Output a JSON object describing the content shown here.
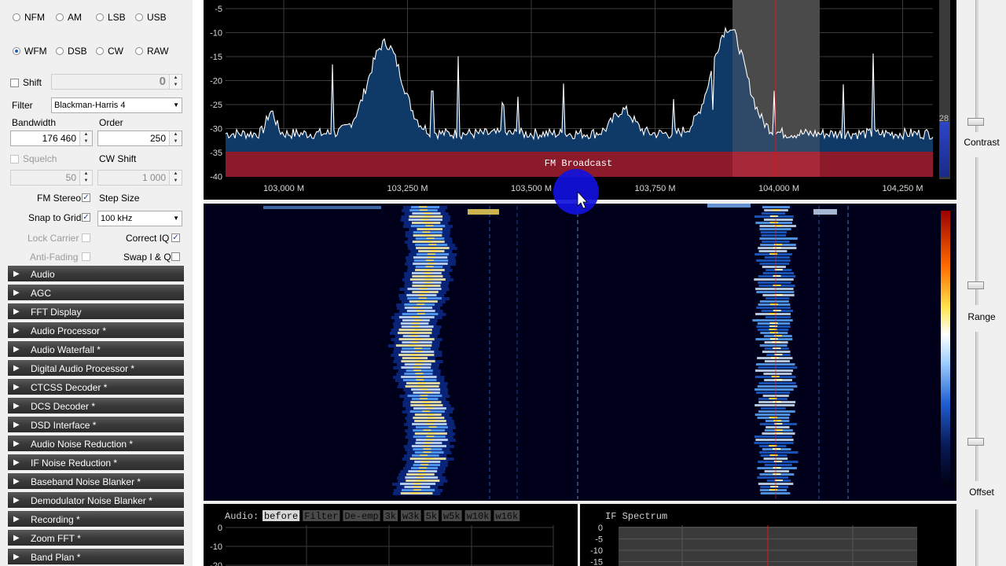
{
  "modes": {
    "nfm": "NFM",
    "am": "AM",
    "lsb": "LSB",
    "usb": "USB",
    "wfm": "WFM",
    "dsb": "DSB",
    "cw": "CW",
    "raw": "RAW",
    "selected": "WFM"
  },
  "shift": {
    "label": "Shift",
    "value": "0",
    "checked": false
  },
  "filter": {
    "label": "Filter",
    "value": "Blackman-Harris 4"
  },
  "bandwidth": {
    "label": "Bandwidth",
    "value": "176 460"
  },
  "order": {
    "label": "Order",
    "value": "250"
  },
  "squelch": {
    "label": "Squelch",
    "value": "50",
    "checked": false
  },
  "cw_shift": {
    "label": "CW Shift",
    "value": "1 000"
  },
  "fm_stereo": {
    "label": "FM Stereo",
    "checked": true
  },
  "step_size": {
    "label": "Step Size",
    "value": "100 kHz"
  },
  "snap_to_grid": {
    "label": "Snap to Grid",
    "checked": true
  },
  "lock_carrier": {
    "label": "Lock Carrier",
    "checked": false
  },
  "correct_iq": {
    "label": "Correct IQ",
    "checked": true
  },
  "anti_fading": {
    "label": "Anti-Fading",
    "checked": false
  },
  "swap_iq": {
    "label": "Swap I & Q",
    "checked": false
  },
  "panels": [
    "Audio",
    "AGC",
    "FFT Display",
    "Audio Processor *",
    "Audio Waterfall *",
    "Digital Audio Processor *",
    "CTCSS Decoder *",
    "DCS Decoder *",
    "DSD Interface *",
    "Audio Noise Reduction *",
    "IF Noise Reduction *",
    "Baseband Noise Blanker *",
    "Demodulator Noise Blanker *",
    "Recording *",
    "Zoom FFT *",
    "Band Plan *"
  ],
  "spectrum": {
    "y_ticks": [
      "-5",
      "-10",
      "-15",
      "-20",
      "-25",
      "-30",
      "-35",
      "-40"
    ],
    "x_ticks": [
      "103,000 M",
      "103,250 M",
      "103,500 M",
      "103,750 M",
      "104,000 M",
      "104,250 M"
    ],
    "band_label": "FM Broadcast",
    "level_value": "28"
  },
  "sliders": {
    "contrast": "Contrast",
    "range": "Range",
    "offset": "Offset"
  },
  "audio_panel": {
    "title": "Audio:",
    "buttons": [
      "before",
      "Filter",
      "De-emp",
      "3k",
      "w3k",
      "5k",
      "w5k",
      "w10k",
      "w16k"
    ],
    "y_ticks": [
      "0",
      "-10",
      "-20"
    ]
  },
  "if_panel": {
    "title": "IF Spectrum",
    "y_ticks": [
      "0",
      "-5",
      "-10",
      "-15"
    ]
  },
  "colors": {
    "accent": "#1c5fbf",
    "spectrum_fill": "#103e6e",
    "band": "#8b1a2b",
    "marker": "#d01818"
  }
}
